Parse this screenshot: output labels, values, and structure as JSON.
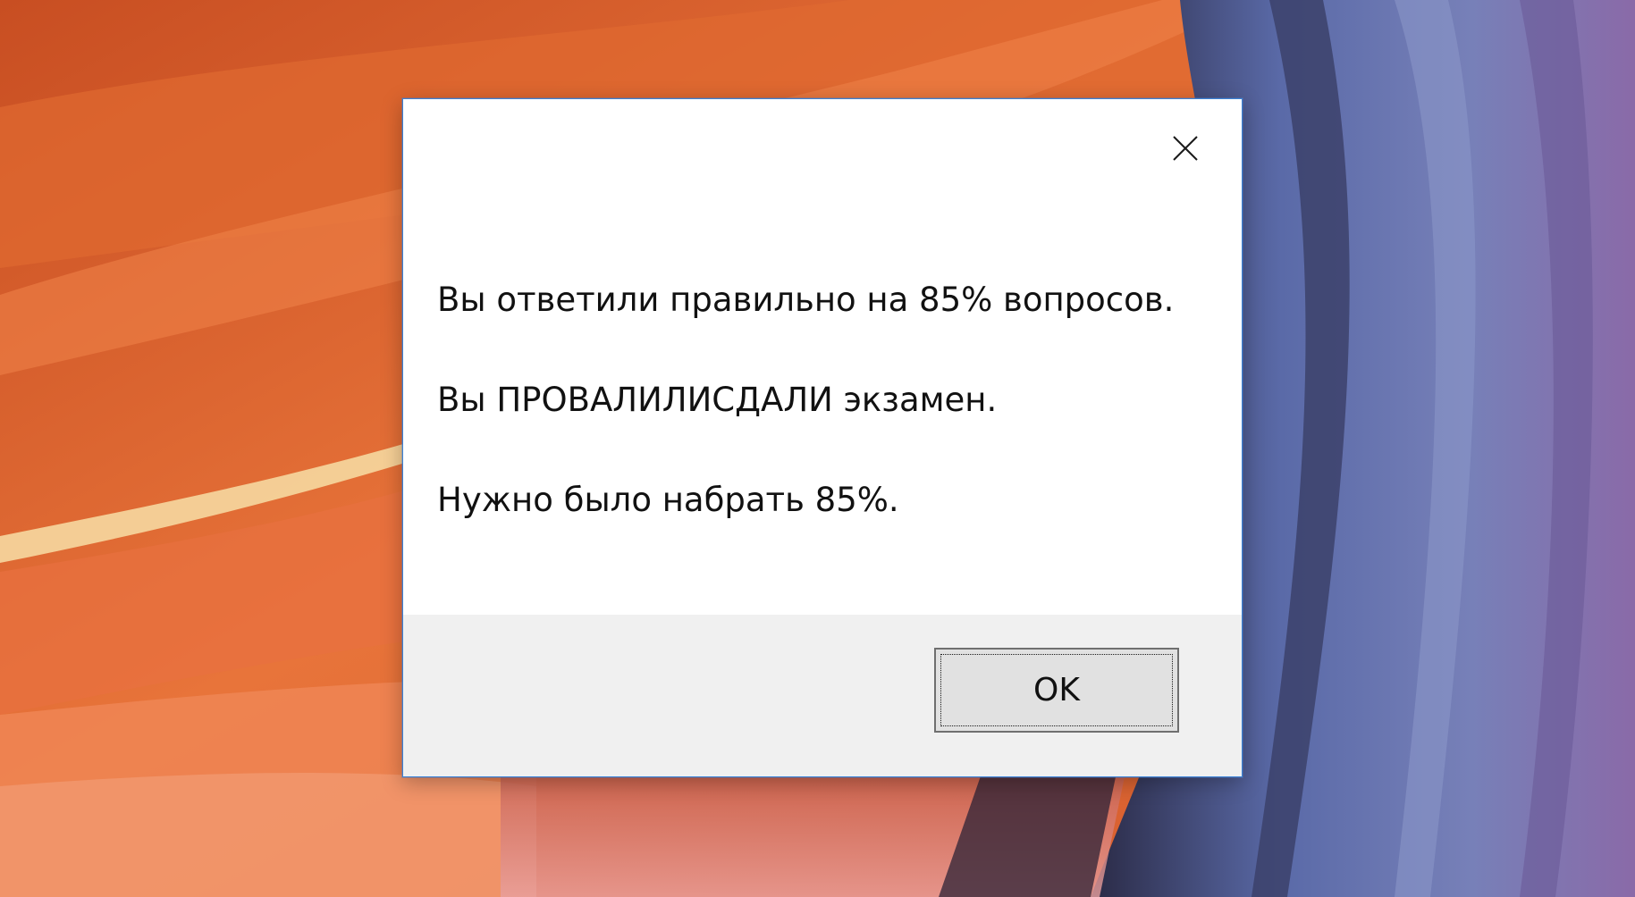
{
  "dialog": {
    "messages": [
      "Вы ответили правильно на 85% вопросов.",
      "Вы ПРОВАЛИЛИСДАЛИ экзамен.",
      "Нужно было набрать 85%."
    ],
    "ok_label": "OK",
    "close_icon": "close-icon"
  },
  "colors": {
    "desktop_orange": "#d8602c",
    "desktop_blue": "#5a6aa0",
    "dialog_border": "#3b82d6",
    "footer_bg": "#f0f0f0",
    "button_bg": "#e1e1e1"
  }
}
